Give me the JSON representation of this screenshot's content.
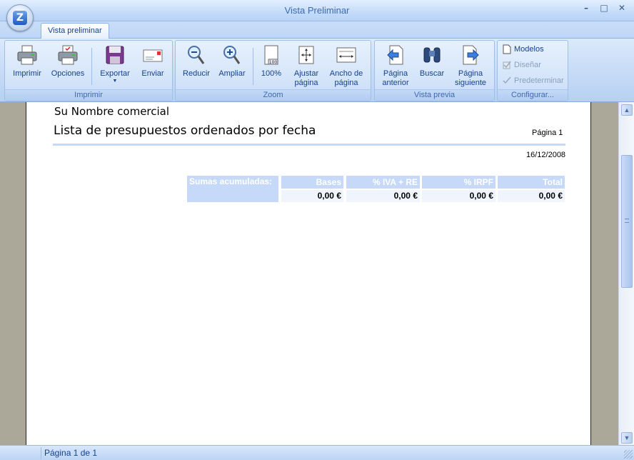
{
  "window": {
    "title": "Vista Preliminar",
    "minimize": "–",
    "maximize": "□",
    "close": "✕",
    "orb_letter": "Z"
  },
  "tabs": [
    {
      "label": "Vista preliminar"
    }
  ],
  "ribbon": {
    "groups": {
      "imprimir": {
        "label": "Imprimir",
        "buttons": {
          "imprimir": "Imprimir",
          "opciones": "Opciones",
          "exportar": "Exportar",
          "enviar": "Enviar"
        }
      },
      "zoom": {
        "label": "Zoom",
        "buttons": {
          "reducir": "Reducir",
          "ampliar": "Ampliar",
          "cien": "100%",
          "ajustar_1": "Ajustar",
          "ajustar_2": "página",
          "ancho_1": "Ancho de",
          "ancho_2": "página"
        }
      },
      "vista": {
        "label": "Vista previa",
        "buttons": {
          "anterior_1": "Página",
          "anterior_2": "anterior",
          "buscar": "Buscar",
          "siguiente_1": "Página",
          "siguiente_2": "siguiente"
        }
      },
      "configurar": {
        "label": "Configurar...",
        "buttons": {
          "modelos": "Modelos",
          "disenar": "Diseñar",
          "predeterminar": "Predeterminar"
        }
      }
    }
  },
  "report": {
    "company": "Su Nombre comercial",
    "title": "Lista de presupuestos ordenados por fecha",
    "page_label": "Página 1",
    "date": "16/12/2008",
    "totals_label": "Sumas acumuladas:",
    "columns": [
      "Bases",
      "% IVA + RE",
      "% IRPF",
      "Total"
    ],
    "values": [
      "0,00 €",
      "0,00 €",
      "0,00 €",
      "0,00 €"
    ]
  },
  "scrollbar": {
    "up": "▲",
    "down": "▼"
  },
  "status": {
    "text": "Página 1 de 1"
  },
  "colors": {
    "accent": "#15428b",
    "ribbon": "#c6dbf6",
    "table_header": "#c6d9f8",
    "preview_bg": "#aca899"
  }
}
